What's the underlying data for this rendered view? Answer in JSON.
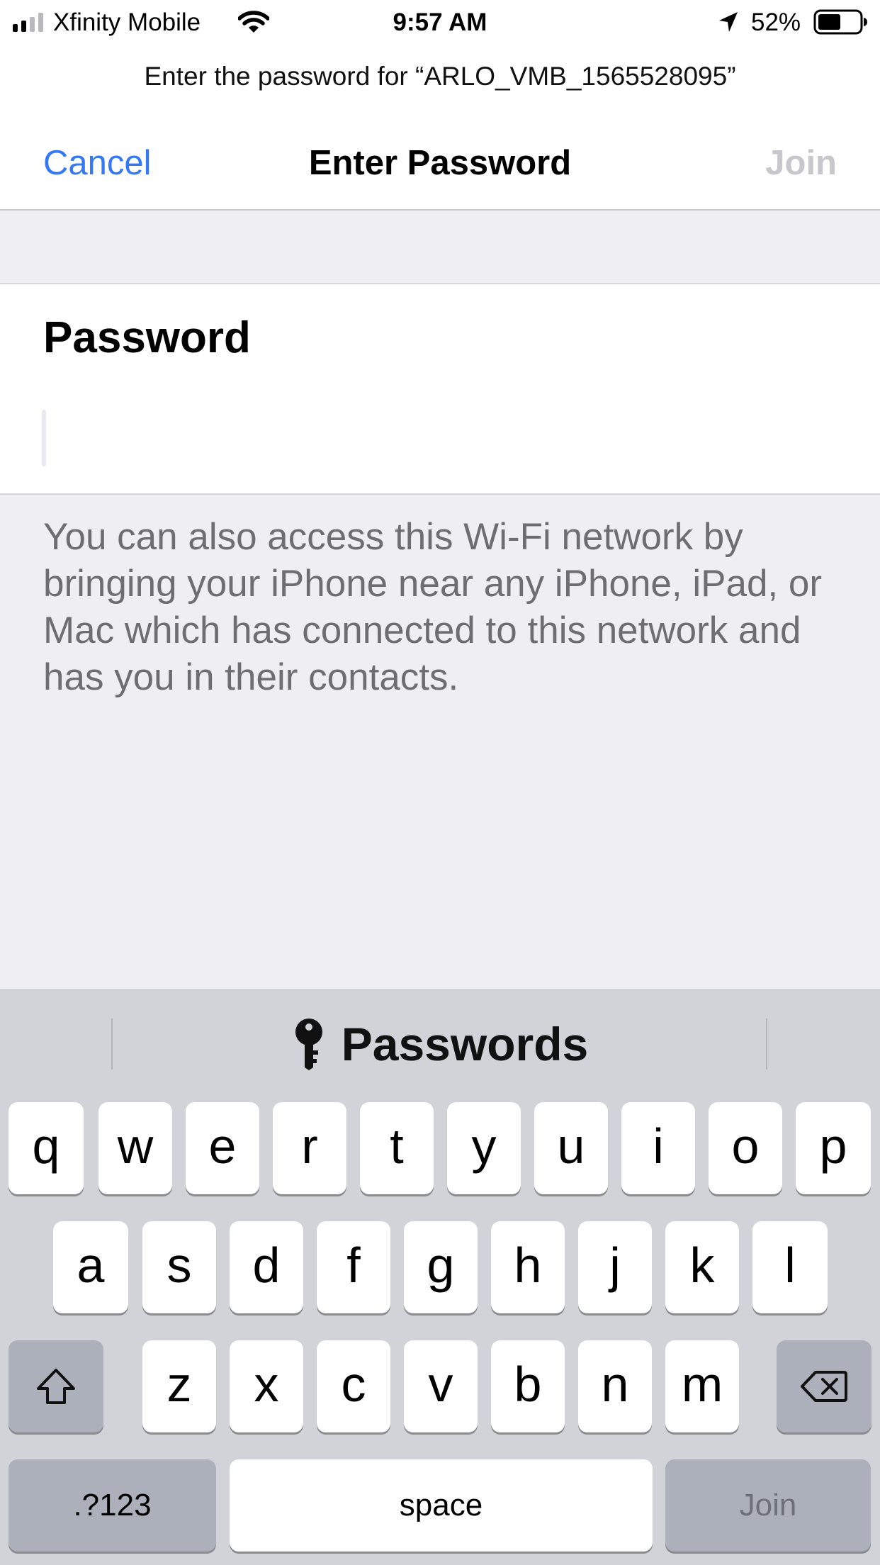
{
  "status_bar": {
    "carrier": "Xfinity Mobile",
    "time": "9:57 AM",
    "battery_percent": "52%",
    "signal_bars_filled": 2,
    "signal_bars_total": 4,
    "battery_level": 0.52,
    "icons": [
      "signal-icon",
      "wifi-icon",
      "location-arrow-icon",
      "battery-icon"
    ]
  },
  "nav": {
    "prompt": "Enter the password for “ARLO_VMB_1565528095”",
    "cancel_label": "Cancel",
    "title": "Enter Password",
    "join_label": "Join",
    "join_enabled": false
  },
  "form": {
    "password_label": "Password",
    "password_value": "",
    "footer_note": "You can also access this Wi-Fi network by bringing your iPhone near any iPhone, iPad, or Mac which has connected to this network and has you in their contacts."
  },
  "keyboard": {
    "suggestion_label": "Passwords",
    "suggestion_icon": "key-icon",
    "row1": [
      "q",
      "w",
      "e",
      "r",
      "t",
      "y",
      "u",
      "i",
      "o",
      "p"
    ],
    "row2": [
      "a",
      "s",
      "d",
      "f",
      "g",
      "h",
      "j",
      "k",
      "l"
    ],
    "row3": [
      "z",
      "x",
      "c",
      "v",
      "b",
      "n",
      "m"
    ],
    "shift_icon": "shift-icon",
    "delete_icon": "delete-backspace-icon",
    "numbers_label": ".?123",
    "space_label": "space",
    "return_label": "Join"
  },
  "colors": {
    "accent": "#3478F6",
    "disabled": "#C7C7CC",
    "grouped_background": "#EEEEF3",
    "keyboard_background": "#D1D3D9",
    "dark_key": "#ABB0BA"
  }
}
